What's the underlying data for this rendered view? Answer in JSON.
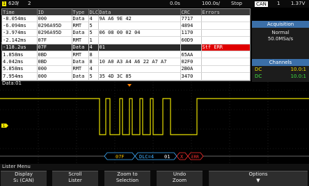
{
  "topbar": {
    "ch_number": "1",
    "timebase": "620ͭ/",
    "ch_scale": "2",
    "time_ref": "0.0s",
    "time_div": "100.0s/",
    "run_state": "Stop",
    "trigger_type": "CAN",
    "trigger_ch": "1",
    "trigger_level": "1.37V"
  },
  "lister": {
    "columns": [
      "Time",
      "ID",
      "Type",
      "DLC",
      "Data",
      "CRC",
      "Errors"
    ],
    "rows": [
      {
        "time": "-8.054ms",
        "id": "000",
        "type": "Data",
        "dlc": "4",
        "data": "9A A6 9E 42",
        "crc": "7717",
        "errors": ""
      },
      {
        "time": "-6.094ms",
        "id": "0296A95D",
        "type": "RMT",
        "dlc": "5",
        "data": "",
        "crc": "4894",
        "errors": ""
      },
      {
        "time": "-3.974ms",
        "id": "0296A95D",
        "type": "Data",
        "dlc": "5",
        "data": "06 08 00 02 04",
        "crc": "1170",
        "errors": ""
      },
      {
        "time": "-2.142ms",
        "id": "07F",
        "type": "RMT",
        "dlc": "1",
        "data": "",
        "crc": "60D9",
        "errors": ""
      },
      {
        "time": "-118.2us",
        "id": "07F",
        "type": "Data",
        "dlc": "4",
        "data": "01",
        "crc": "",
        "errors": "Stf ERR"
      },
      {
        "time": "1.858ms",
        "id": "0BD",
        "type": "RMT",
        "dlc": "8",
        "data": "",
        "crc": "65AA",
        "errors": ""
      },
      {
        "time": "4.042ms",
        "id": "0BD",
        "type": "Data",
        "dlc": "8",
        "data": "10 A0 A3 A4 A6 22 A7 A7",
        "crc": "02F0",
        "errors": ""
      },
      {
        "time": "5.858ms",
        "id": "000",
        "type": "RMT",
        "dlc": "4",
        "data": "",
        "crc": "2B0A",
        "errors": ""
      },
      {
        "time": "7.954ms",
        "id": "000",
        "type": "Data",
        "dlc": "5",
        "data": "35 4D 3C 85",
        "crc": "3470",
        "errors": ""
      }
    ],
    "selected_index": 4
  },
  "acquisition": {
    "title": "Acquisition",
    "mode": "Normal",
    "rate": "50.0MSa/s"
  },
  "channels": {
    "title": "Channels",
    "rows": [
      {
        "coupling": "DC",
        "value": "10.0:1"
      },
      {
        "coupling": "DC",
        "value": "10.0:1"
      }
    ]
  },
  "wave": {
    "label": "Data:01",
    "decode": {
      "id": "07F",
      "dlc": "DLC=4",
      "data": "01",
      "err1": "X",
      "err2": "ERR"
    },
    "colors": {
      "trace": "#e8e000",
      "decode_id": "#f0c000",
      "decode_dlc": "#40b0ff",
      "error": "#ff3030"
    },
    "ch_marker": "1"
  },
  "menu": {
    "title": "Lister Menu",
    "softkeys": [
      {
        "l1": "Display",
        "l2": "S₁ (CAN)"
      },
      {
        "l1": "Scroll",
        "l2": "Lister"
      },
      {
        "l1": "Zoom to",
        "l2": "Selection"
      },
      {
        "l1": "Undo",
        "l2": "Zoom"
      },
      {
        "l1": "Options",
        "l2": "▼"
      }
    ]
  }
}
